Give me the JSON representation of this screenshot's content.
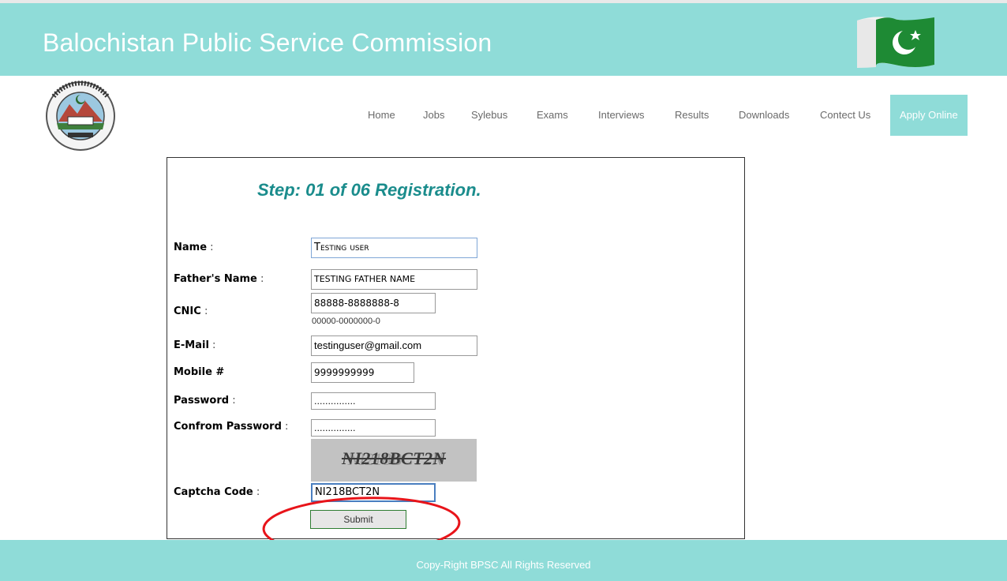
{
  "header": {
    "title": "Balochistan Public Service Commission",
    "flag_icon": "pakistan-flag-icon",
    "bg_color": "#8fdcd8"
  },
  "logo": {
    "icon": "bpsc-emblem-icon",
    "text": "BALOCHISTAN PUBLIC SERVICE COMMISSION"
  },
  "nav": {
    "items": [
      "Home",
      "Jobs",
      "Sylebus",
      "Exams",
      "Interviews",
      "Results",
      "Downloads",
      "Contect Us"
    ],
    "apply": "Apply Online"
  },
  "form": {
    "step_title": "Step: 01 of 06 Registration.",
    "name": {
      "label": "Name",
      "value": "Testing user"
    },
    "father": {
      "label": "Father's Name",
      "value": "TESTING FATHER NAME"
    },
    "cnic": {
      "label": "CNIC",
      "value": "88888-8888888-8",
      "hint": "00000-0000000-0"
    },
    "email": {
      "label": "E-Mail",
      "value": "testinguser@gmail.com"
    },
    "mobile": {
      "label": "Mobile #",
      "value": "9999999999"
    },
    "password": {
      "label": "Password",
      "value": "..............."
    },
    "confirm": {
      "label": "Confrom Password",
      "value": "..............."
    },
    "captcha": {
      "image_text": "NI218BCT2N",
      "label": "Captcha Code",
      "value": "NI218BCT2N"
    },
    "submit": "Submit"
  },
  "annotation": {
    "color": "#e8141a",
    "shape": "ellipse-around-submit"
  },
  "footer": {
    "text": "Copy-Right BPSC All Rights Reserved"
  }
}
